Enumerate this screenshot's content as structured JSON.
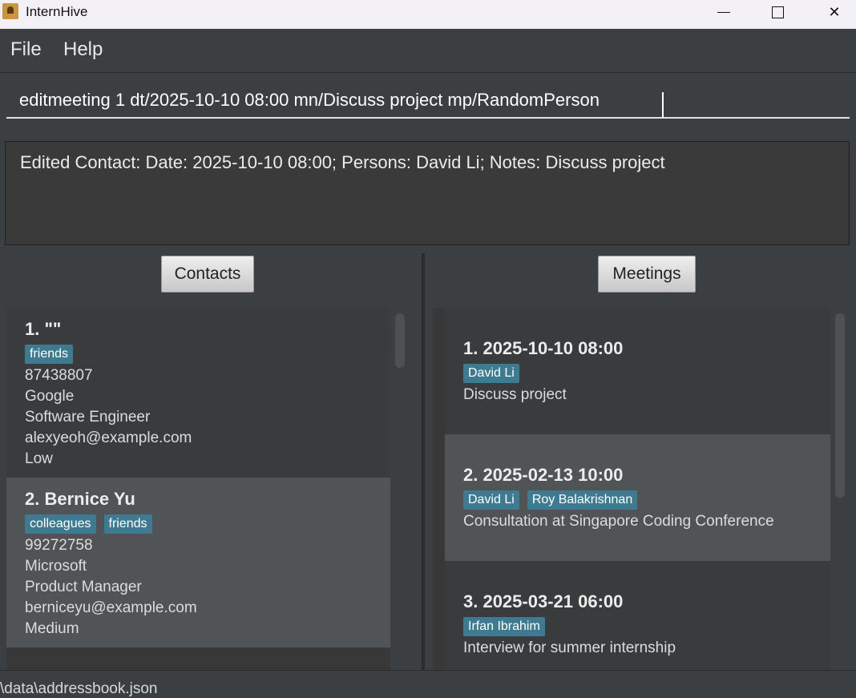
{
  "window": {
    "title": "InternHive",
    "minimize": "—",
    "maximize": "☐",
    "close": "✕"
  },
  "menu": {
    "file": "File",
    "help": "Help"
  },
  "command": {
    "value": "editmeeting 1 dt/2025-10-10 08:00 mn/Discuss project mp/RandomPerson"
  },
  "result": {
    "text": "Edited Contact: Date: 2025-10-10 08:00; Persons: David Li; Notes: Discuss project"
  },
  "contacts": {
    "header": "Contacts",
    "items": [
      {
        "title": "1. \"\"",
        "tags": [
          "friends"
        ],
        "phone": "87438807",
        "company": "Google",
        "role": "Software Engineer",
        "email": "alexyeoh@example.com",
        "priority": "Low"
      },
      {
        "title": "2. Bernice Yu",
        "tags": [
          "colleagues",
          "friends"
        ],
        "phone": "99272758",
        "company": "Microsoft",
        "role": "Product Manager",
        "email": "berniceyu@example.com",
        "priority": "Medium"
      }
    ]
  },
  "meetings": {
    "header": "Meetings",
    "items": [
      {
        "title": "1. 2025-10-10 08:00",
        "persons": [
          "David Li"
        ],
        "note": "Discuss project"
      },
      {
        "title": "2. 2025-02-13 10:00",
        "persons": [
          "David Li",
          "Roy Balakrishnan"
        ],
        "note": "Consultation at Singapore Coding Conference"
      },
      {
        "title": "3. 2025-03-21 06:00",
        "persons": [
          "Irfan Ibrahim"
        ],
        "note": "Interview for summer internship"
      }
    ]
  },
  "status": {
    "path": "\\data\\addressbook.json"
  },
  "colors": {
    "background": "#3c3f41",
    "tag": "#3e7b91",
    "selected_card": "#505456"
  }
}
